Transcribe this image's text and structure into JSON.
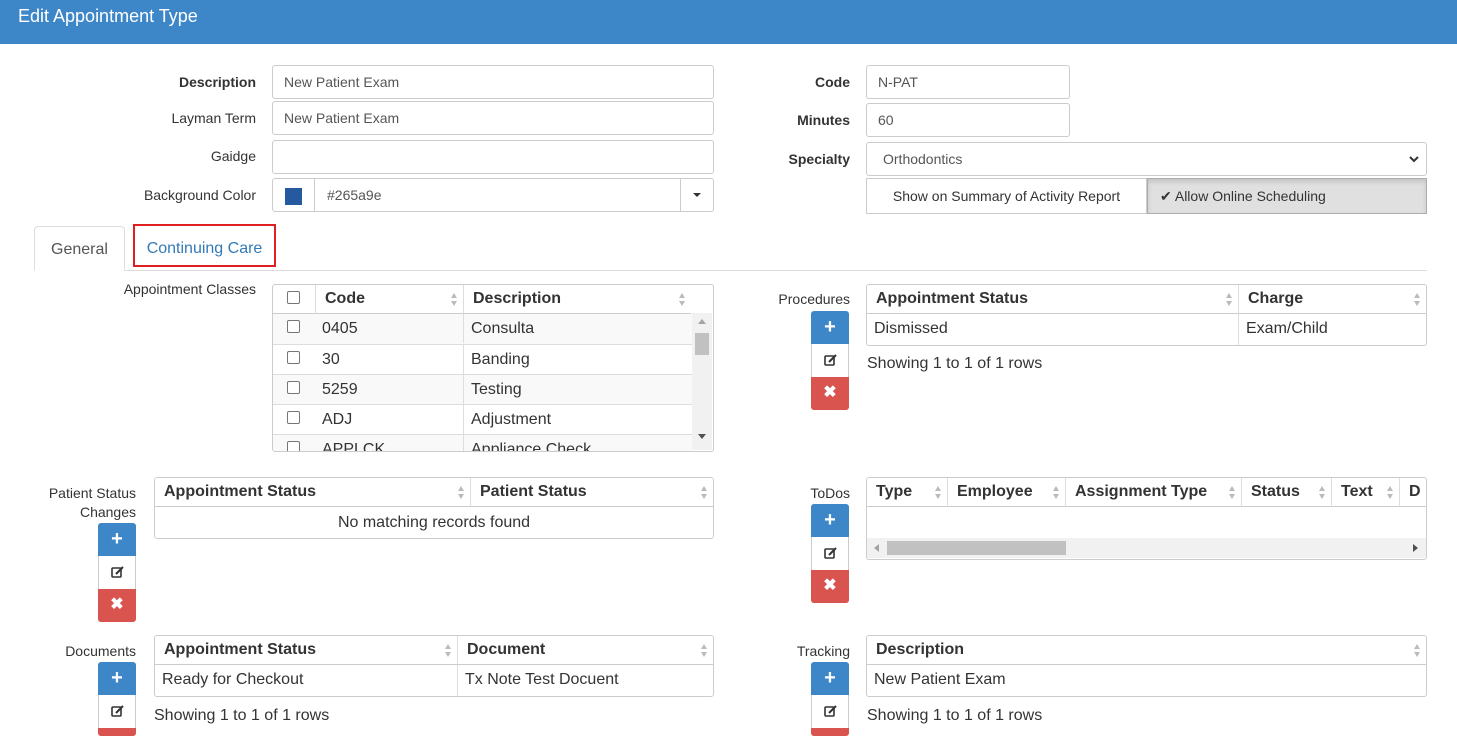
{
  "header": {
    "title": "Edit Appointment Type"
  },
  "form": {
    "description_label": "Description",
    "description_value": "New Patient Exam",
    "layman_label": "Layman Term",
    "layman_value": "New Patient Exam",
    "gaidge_label": "Gaidge",
    "gaidge_value": "",
    "bgcolor_label": "Background Color",
    "bgcolor_value": "#265a9e",
    "code_label": "Code",
    "code_value": "N-PAT",
    "minutes_label": "Minutes",
    "minutes_value": "60",
    "specialty_label": "Specialty",
    "specialty_value": "Orthodontics",
    "summary_btn": "Show on Summary of Activity Report",
    "online_btn": "Allow Online Scheduling"
  },
  "tabs": {
    "general": "General",
    "continuing_care": "Continuing Care"
  },
  "appt_classes": {
    "label": "Appointment Classes",
    "headers": [
      "Code",
      "Description"
    ],
    "rows": [
      {
        "code": "0405",
        "desc": "Consulta"
      },
      {
        "code": "30",
        "desc": "Banding"
      },
      {
        "code": "5259",
        "desc": "Testing"
      },
      {
        "code": "ADJ",
        "desc": "Adjustment"
      },
      {
        "code": "APPLCK",
        "desc": "Appliance Check"
      }
    ]
  },
  "procedures": {
    "label": "Procedures",
    "headers": [
      "Appointment Status",
      "Charge"
    ],
    "rows": [
      {
        "status": "Dismissed",
        "charge": "Exam/Child"
      }
    ],
    "info": "Showing 1 to 1 of 1 rows"
  },
  "patient_status": {
    "label1": "Patient Status",
    "label2": "Changes",
    "headers": [
      "Appointment Status",
      "Patient Status"
    ],
    "empty": "No matching records found"
  },
  "todos": {
    "label": "ToDos",
    "headers": [
      "Type",
      "Employee",
      "Assignment Type",
      "Status",
      "Text",
      "D"
    ]
  },
  "documents": {
    "label": "Documents",
    "headers": [
      "Appointment Status",
      "Document"
    ],
    "rows": [
      {
        "status": "Ready for Checkout",
        "doc": "Tx Note Test Docuent"
      }
    ],
    "info": "Showing 1 to 1 of 1 rows"
  },
  "tracking": {
    "label": "Tracking",
    "headers": [
      "Description"
    ],
    "rows": [
      {
        "desc": "New Patient Exam"
      }
    ],
    "info": "Showing 1 to 1 of 1 rows"
  },
  "icons": {
    "add": "+",
    "delete": "✖",
    "check": "✔",
    "chevron": "⌄"
  },
  "colors": {
    "header": "#3d87c9",
    "swatch": "#265a9e",
    "danger": "#d9534f",
    "highlight": "#e02020"
  }
}
